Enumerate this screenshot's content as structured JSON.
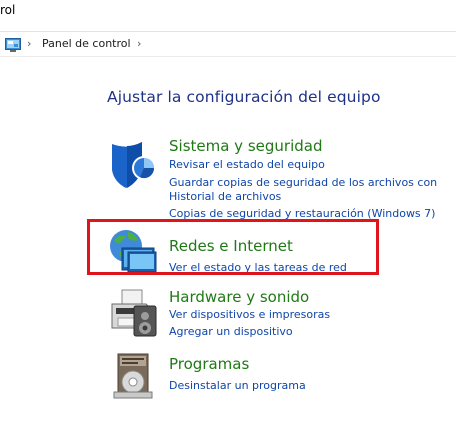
{
  "window": {
    "title": "rol"
  },
  "addressbar": {
    "icon": "control-panel-icon",
    "breadcrumb": "Panel de control"
  },
  "heading": "Ajustar la configuración del equipo",
  "categories": [
    {
      "title": "Sistema y seguridad",
      "icon": "shield-icon",
      "links": [
        "Revisar el estado del equipo",
        "Guardar copias de seguridad de los archivos con",
        "Historial de archivos",
        "Copias de seguridad y restauración (Windows 7)"
      ]
    },
    {
      "title": "Redes e Internet",
      "icon": "network-icon",
      "links": [
        "Ver el estado y las tareas de red"
      ]
    },
    {
      "title": "Hardware y sonido",
      "icon": "printer-icon",
      "links": [
        "Ver dispositivos e impresoras",
        "Agregar un dispositivo"
      ]
    },
    {
      "title": "Programas",
      "icon": "programs-icon",
      "links": [
        "Desinstalar un programa"
      ]
    }
  ],
  "colors": {
    "heading": "#1e3287",
    "category_title": "#1f7a15",
    "link": "#0f46a8",
    "highlight": "#e0151b"
  }
}
